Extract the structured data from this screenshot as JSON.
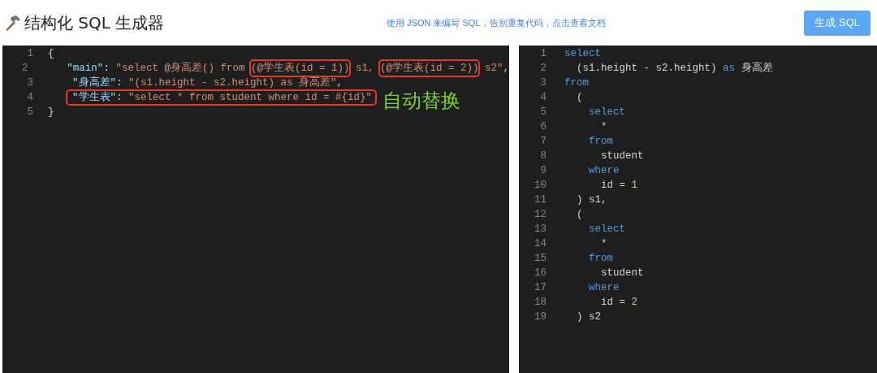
{
  "header": {
    "title": "结构化 SQL 生成器",
    "doc_link": "使用 JSON 来编写 SQL，告别重复代码，点击查看文档",
    "button": "生成 SQL"
  },
  "input_editor": {
    "lines": [
      {
        "number": "1",
        "boxed": false,
        "tokens": [
          {
            "text": "{",
            "kind": "punct"
          }
        ],
        "children": [
          {
            "number": "2",
            "boxed": false,
            "tokens": [
              {
                "text": "\"main\"",
                "kind": "key"
              },
              {
                "text": ": ",
                "kind": "punct"
              },
              {
                "text": "\"select @身高差() from ",
                "kind": "string"
              },
              {
                "text": "(@学生表(id = 1))",
                "kind": "string",
                "boxed": true
              },
              {
                "text": " s1, ",
                "kind": "string"
              },
              {
                "text": "(@学生表(id = 2))",
                "kind": "string",
                "boxed": true
              },
              {
                "text": " s2\"",
                "kind": "string"
              },
              {
                "text": ",",
                "kind": "punct"
              }
            ]
          },
          {
            "number": "3",
            "boxed": false,
            "tokens": [
              {
                "text": "\"身高差\"",
                "kind": "key"
              },
              {
                "text": ": ",
                "kind": "punct"
              },
              {
                "text": "\"(s1.height - s2.height) as 身高差\"",
                "kind": "string"
              },
              {
                "text": ",",
                "kind": "punct"
              }
            ]
          },
          {
            "number": "4",
            "boxed": true,
            "tokens": [
              {
                "text": "\"学生表\"",
                "kind": "key"
              },
              {
                "text": ": ",
                "kind": "punct"
              },
              {
                "text": "\"select * from student where id = #{id}\"",
                "kind": "string"
              }
            ]
          }
        ]
      },
      {
        "number": "5",
        "boxed": false,
        "tokens": [
          {
            "text": "}",
            "kind": "punct"
          }
        ]
      }
    ],
    "annotation": "自动替换"
  },
  "output_editor": {
    "lines": [
      {
        "number": "1",
        "tokens": [
          {
            "text": "select",
            "kind": "keyword"
          }
        ]
      },
      {
        "number": "2",
        "tokens": [
          {
            "text": "  (s1.height - s2.height) ",
            "kind": "plain"
          },
          {
            "text": "as",
            "kind": "keyword"
          },
          {
            "text": " 身高差",
            "kind": "plain"
          }
        ]
      },
      {
        "number": "3",
        "tokens": [
          {
            "text": "from",
            "kind": "keyword"
          }
        ]
      },
      {
        "number": "4",
        "tokens": [
          {
            "text": "  (",
            "kind": "plain"
          }
        ]
      },
      {
        "number": "5",
        "tokens": [
          {
            "text": "    select",
            "kind": "keyword"
          }
        ]
      },
      {
        "number": "6",
        "tokens": [
          {
            "text": "      *",
            "kind": "plain"
          }
        ]
      },
      {
        "number": "7",
        "tokens": [
          {
            "text": "    from",
            "kind": "keyword"
          }
        ]
      },
      {
        "number": "8",
        "tokens": [
          {
            "text": "      student",
            "kind": "plain"
          }
        ]
      },
      {
        "number": "9",
        "tokens": [
          {
            "text": "    where",
            "kind": "keyword"
          }
        ]
      },
      {
        "number": "10",
        "tokens": [
          {
            "text": "      id = ",
            "kind": "plain"
          },
          {
            "text": "1",
            "kind": "number"
          }
        ]
      },
      {
        "number": "11",
        "tokens": [
          {
            "text": "  ) s1,",
            "kind": "plain"
          }
        ]
      },
      {
        "number": "12",
        "tokens": [
          {
            "text": "  (",
            "kind": "plain"
          }
        ]
      },
      {
        "number": "13",
        "tokens": [
          {
            "text": "    select",
            "kind": "keyword"
          }
        ]
      },
      {
        "number": "14",
        "tokens": [
          {
            "text": "      *",
            "kind": "plain"
          }
        ]
      },
      {
        "number": "15",
        "tokens": [
          {
            "text": "    from",
            "kind": "keyword"
          }
        ]
      },
      {
        "number": "16",
        "tokens": [
          {
            "text": "      student",
            "kind": "plain"
          }
        ]
      },
      {
        "number": "17",
        "tokens": [
          {
            "text": "    where",
            "kind": "keyword"
          }
        ]
      },
      {
        "number": "18",
        "tokens": [
          {
            "text": "      id = ",
            "kind": "plain"
          },
          {
            "text": "2",
            "kind": "number"
          }
        ]
      },
      {
        "number": "19",
        "tokens": [
          {
            "text": "  ) s2",
            "kind": "plain"
          }
        ]
      }
    ]
  }
}
